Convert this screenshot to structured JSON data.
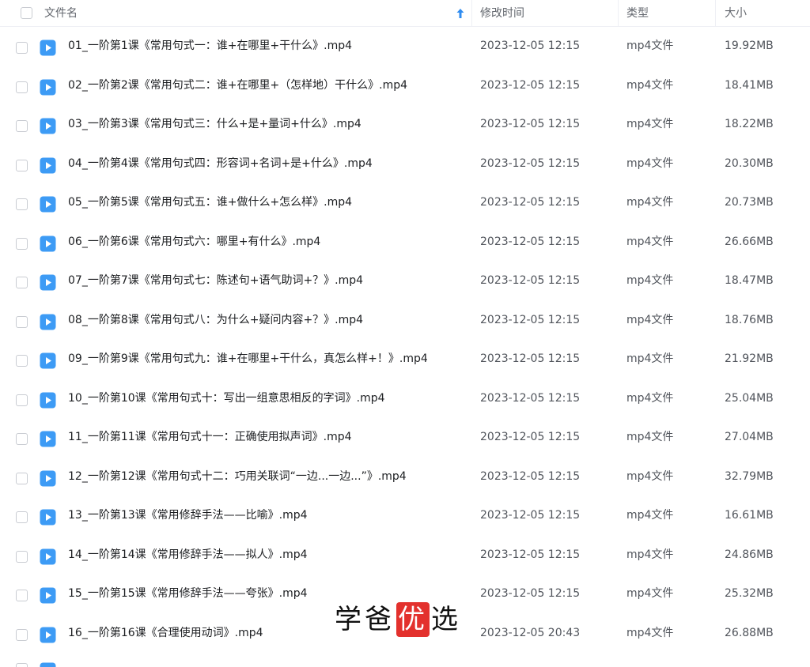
{
  "header": {
    "name_label": "文件名",
    "time_label": "修改时间",
    "type_label": "类型",
    "size_label": "大小"
  },
  "colors": {
    "accent": "#2f8cf0",
    "icon_blue": "#3d9bf5",
    "watermark_red": "#e3312d"
  },
  "files": [
    {
      "name": "01_一阶第1课《常用句式一：谁+在哪里+干什么》.mp4",
      "time": "2023-12-05 12:15",
      "type": "mp4文件",
      "size": "19.92MB"
    },
    {
      "name": "02_一阶第2课《常用句式二：谁+在哪里+（怎样地）干什么》.mp4",
      "time": "2023-12-05 12:15",
      "type": "mp4文件",
      "size": "18.41MB"
    },
    {
      "name": "03_一阶第3课《常用句式三：什么+是+量词+什么》.mp4",
      "time": "2023-12-05 12:15",
      "type": "mp4文件",
      "size": "18.22MB"
    },
    {
      "name": "04_一阶第4课《常用句式四：形容词+名词+是+什么》.mp4",
      "time": "2023-12-05 12:15",
      "type": "mp4文件",
      "size": "20.30MB"
    },
    {
      "name": "05_一阶第5课《常用句式五：谁+做什么+怎么样》.mp4",
      "time": "2023-12-05 12:15",
      "type": "mp4文件",
      "size": "20.73MB"
    },
    {
      "name": "06_一阶第6课《常用句式六：哪里+有什么》.mp4",
      "time": "2023-12-05 12:15",
      "type": "mp4文件",
      "size": "26.66MB"
    },
    {
      "name": "07_一阶第7课《常用句式七：陈述句+语气助词+？》.mp4",
      "time": "2023-12-05 12:15",
      "type": "mp4文件",
      "size": "18.47MB"
    },
    {
      "name": "08_一阶第8课《常用句式八：为什么+疑问内容+？》.mp4",
      "time": "2023-12-05 12:15",
      "type": "mp4文件",
      "size": "18.76MB"
    },
    {
      "name": "09_一阶第9课《常用句式九：谁+在哪里+干什么，真怎么样+！》.mp4",
      "time": "2023-12-05 12:15",
      "type": "mp4文件",
      "size": "21.92MB"
    },
    {
      "name": "10_一阶第10课《常用句式十：写出一组意思相反的字词》.mp4",
      "time": "2023-12-05 12:15",
      "type": "mp4文件",
      "size": "25.04MB"
    },
    {
      "name": "11_一阶第11课《常用句式十一：正确使用拟声词》.mp4",
      "time": "2023-12-05 12:15",
      "type": "mp4文件",
      "size": "27.04MB"
    },
    {
      "name": "12_一阶第12课《常用句式十二：巧用关联词“一边...一边...”》.mp4",
      "time": "2023-12-05 12:15",
      "type": "mp4文件",
      "size": "32.79MB"
    },
    {
      "name": "13_一阶第13课《常用修辞手法——比喻》.mp4",
      "time": "2023-12-05 12:15",
      "type": "mp4文件",
      "size": "16.61MB"
    },
    {
      "name": "14_一阶第14课《常用修辞手法——拟人》.mp4",
      "time": "2023-12-05 12:15",
      "type": "mp4文件",
      "size": "24.86MB"
    },
    {
      "name": "15_一阶第15课《常用修辞手法——夸张》.mp4",
      "time": "2023-12-05 12:15",
      "type": "mp4文件",
      "size": "25.32MB"
    },
    {
      "name": "16_一阶第16课《合理使用动词》.mp4",
      "time": "2023-12-05 20:43",
      "type": "mp4文件",
      "size": "26.88MB"
    }
  ],
  "watermark": {
    "part1": "学爸",
    "highlight": "优",
    "part2": "选"
  }
}
